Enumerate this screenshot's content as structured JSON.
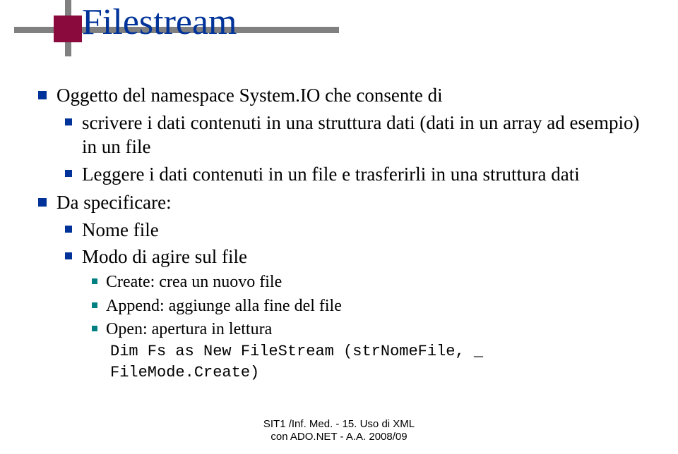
{
  "title": "Filestream",
  "b1": "Oggetto del namespace System.IO che consente di",
  "b1_s1": "scrivere i dati contenuti in una struttura dati (dati in un array ad esempio) in un file",
  "b1_s2": "Leggere i dati contenuti in un file e trasferirli in una struttura dati",
  "b2": "Da specificare:",
  "b2_s1": "Nome file",
  "b2_s2": "Modo di agire sul file",
  "b2_s2_a": "Create: crea un nuovo file",
  "b2_s2_b": "Append: aggiunge alla fine del file",
  "b2_s2_c": "Open: apertura in lettura",
  "code1": "Dim Fs as New FileStream (strNomeFile, _",
  "code2": "FileMode.Create)",
  "footer1": "SIT1 /Inf. Med. - 15. Uso di XML",
  "footer2": "con ADO.NET - A.A. 2008/09"
}
